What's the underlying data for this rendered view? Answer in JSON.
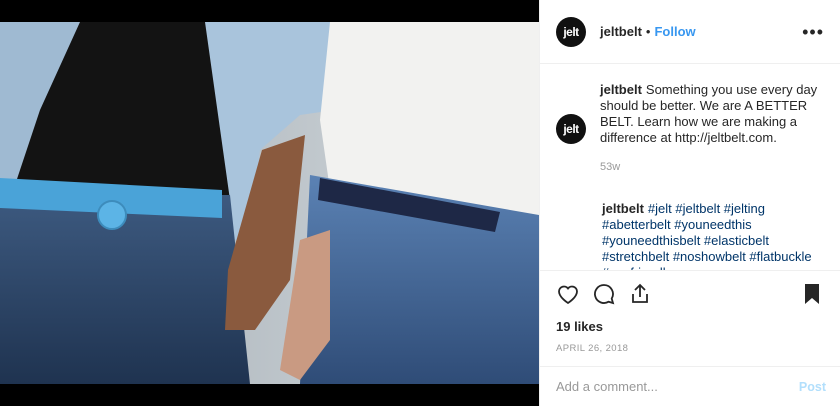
{
  "post": {
    "username": "jeltbelt",
    "avatar_text": "jelt",
    "follow_label": "Follow",
    "separator": "•",
    "more_label": "•••"
  },
  "caption": {
    "username": "jeltbelt",
    "text": "Something you use every day should be better. We are A BETTER BELT. Learn how we are making a difference at http://jeltbelt.com.",
    "age": "53w"
  },
  "comment": {
    "username": "jeltbelt",
    "hashtags": "#jelt #jeltbelt #jelting #abetterbelt #youneedthis #youneedthisbelt #elasticbelt #stretchbelt #noshowbelt #flatbuckle #ecofriendly"
  },
  "stats": {
    "likes": "19 likes",
    "date": "APRIL 26, 2018"
  },
  "add_comment": {
    "placeholder": "Add a comment...",
    "post_label": "Post"
  },
  "icons": [
    "heart-icon",
    "comment-icon",
    "share-icon",
    "bookmark-icon",
    "more-icon",
    "small-heart-icon"
  ],
  "colors": {
    "link": "#3897f0",
    "hashtag": "#003569",
    "post_disabled": "#b2dffc"
  }
}
